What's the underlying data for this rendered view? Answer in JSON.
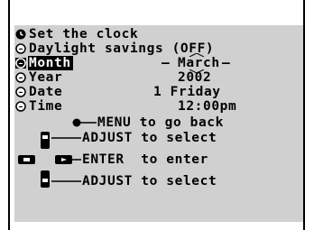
{
  "menu": {
    "title": "Set the clock",
    "items": [
      {
        "label": "Daylight savings (OFF)",
        "value": ""
      },
      {
        "label": "Month",
        "value": "March"
      },
      {
        "label": "Year",
        "value": "2002"
      },
      {
        "label": "Date",
        "value": "1 Friday"
      },
      {
        "label": "Time",
        "value": "12:00pm"
      }
    ]
  },
  "help": {
    "menu": "MENU to go back",
    "adjust_up": "ADJUST to select",
    "enter": "ENTER  to enter",
    "adjust_down": "ADJUST to select"
  },
  "icons": {
    "title": "clock-icon",
    "item": "radio-icon",
    "menu": "menu-button-icon",
    "pad": "dpad-icon"
  },
  "colors": {
    "background": "#d0d0d0",
    "text": "#000000",
    "selection": "#000000",
    "selection_text": "#ffffff"
  }
}
